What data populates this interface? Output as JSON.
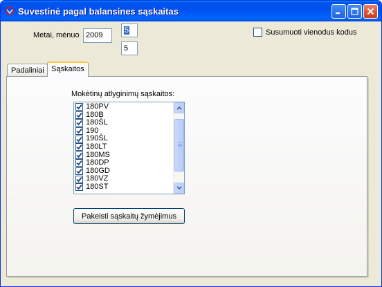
{
  "window": {
    "title": "Suvestinė pagal balansines sąskaitas",
    "icon": "app-icon"
  },
  "period": {
    "label": "Metai, mėnuo",
    "year": "2009",
    "month_top": "5",
    "month_bottom": "5"
  },
  "options": {
    "sum_same_codes_label": "Susumuoti vienodus kodus",
    "sum_same_codes_checked": false
  },
  "tabs": [
    {
      "label": "Padaliniai",
      "active": false
    },
    {
      "label": "Sąskaitos",
      "active": true
    }
  ],
  "accounts": {
    "label": "Mokėtinų atlyginimų sąskaitos:",
    "items": [
      {
        "code": "180PV",
        "checked": true
      },
      {
        "code": "180B",
        "checked": true
      },
      {
        "code": "180ŠL",
        "checked": true
      },
      {
        "code": "190",
        "checked": true
      },
      {
        "code": "190ŠL",
        "checked": true
      },
      {
        "code": "180LT",
        "checked": true
      },
      {
        "code": "180MS",
        "checked": true
      },
      {
        "code": "180DP",
        "checked": true
      },
      {
        "code": "180GD",
        "checked": true
      },
      {
        "code": "180VZ",
        "checked": true
      },
      {
        "code": "180ST",
        "checked": true
      }
    ],
    "change_button_label": "Pakeisti sąskaitų žymėjimus"
  },
  "colors": {
    "titlebar": "#0053ee",
    "window_bg": "#ece9d8",
    "selection": "#316ac5",
    "close_button": "#d8512f"
  }
}
